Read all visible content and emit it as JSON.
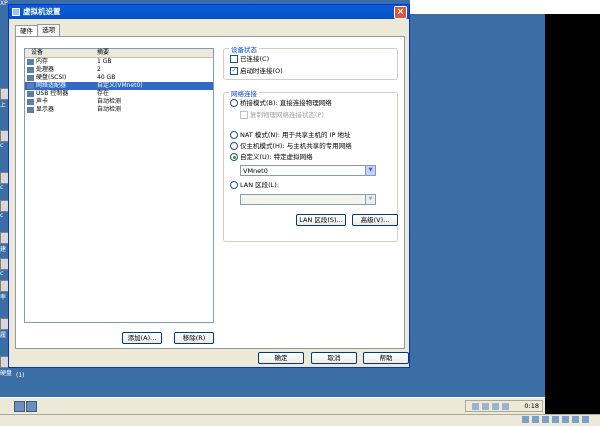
{
  "desktop": {
    "corner_label": "XP",
    "icon_labels": [
      "上",
      "c",
      "c",
      "c",
      "建",
      "c",
      "率",
      "履",
      "硬盘"
    ],
    "bottom_label": "(1)"
  },
  "dialog": {
    "title": "虚拟机设置",
    "close_label": "×",
    "tabs": [
      "硬件",
      "选项"
    ],
    "device_list": {
      "columns": [
        "设备",
        "摘要"
      ],
      "rows": [
        {
          "icon": "memory-icon",
          "name": "内存",
          "summary": "1 GB"
        },
        {
          "icon": "processor-icon",
          "name": "处理器",
          "summary": "2"
        },
        {
          "icon": "disk-icon",
          "name": "硬盘(SCSI)",
          "summary": "40 GB"
        },
        {
          "icon": "network-icon",
          "name": "网络适配器",
          "summary": "自定义(VMnet0)"
        },
        {
          "icon": "usb-icon",
          "name": "USB 控制器",
          "summary": "存在"
        },
        {
          "icon": "sound-icon",
          "name": "声卡",
          "summary": "自动检测"
        },
        {
          "icon": "display-icon",
          "name": "显示器",
          "summary": "自动检测"
        }
      ],
      "selected_index": 3
    },
    "add_button": "添加(A)...",
    "remove_button": "移除(R)",
    "device_status": {
      "title": "设备状态",
      "connected": {
        "label": "已连接(C)",
        "checked": false
      },
      "connect_on_power": {
        "label": "启动时连接(O)",
        "checked": true
      }
    },
    "network_connection": {
      "title": "网络连接",
      "bridged": "桥接模式(B): 直接连接物理网络",
      "replicate": "复制物理网络连接状态(P)",
      "nat": "NAT 模式(N): 用于共享主机的 IP 地址",
      "host_only": "仅主机模式(H): 与主机共享的专用网络",
      "custom": "自定义(U): 特定虚拟网络",
      "custom_value": "VMnet0",
      "lan_segment": "LAN 区段(L):",
      "lan_segment_value": "",
      "selected": "custom"
    },
    "lan_segments_button": "LAN 区段(S)...",
    "advanced_button": "高级(V)...",
    "ok_button": "确定",
    "cancel_button": "取消",
    "help_button": "帮助"
  },
  "taskbar": {
    "clock": "0:18"
  }
}
